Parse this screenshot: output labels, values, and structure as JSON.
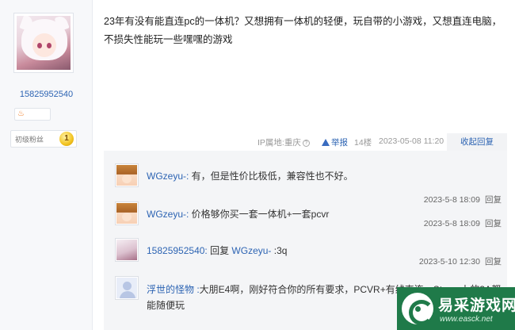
{
  "author": {
    "username": "15825952540",
    "level_label": "初级粉丝",
    "level_number": "1"
  },
  "post": {
    "content": "23年有没有能直连pc的一体机？又想拥有一体机的轻便，玩自带的小游戏，又想直连电脑，不损失性能玩一些嘿嘿的游戏",
    "ip_label": "IP属地:重庆",
    "help_glyph": "?",
    "report_label": "举报",
    "floor": "14楼",
    "date": "2023-05-08 11:20",
    "collapse_label": "收起回复"
  },
  "replies": [
    {
      "name": "WGzeyu-:",
      "text": " 有，但是性价比极低，兼容性也不好。",
      "time": "2023-5-8 18:09",
      "reply_label": "回复",
      "avatar": "anime-girl-avatar"
    },
    {
      "name": "WGzeyu-:",
      "text": " 价格够你买一套一体机+一套pcvr",
      "time": "2023-5-8 18:09",
      "reply_label": "回复",
      "avatar": "anime-girl-avatar"
    },
    {
      "name": "15825952540:",
      "reply_word": " 回复 ",
      "target": "WGzeyu-",
      "text": " :3q",
      "time": "2023-5-10 12:30",
      "reply_label": "回复",
      "avatar": "white-hair-avatar"
    },
    {
      "name": "浮世的怪物 :",
      "text": "大朋E4啊，刚好符合你的所有要求，PCVR+有线直连，Steam上的3A都能随便玩",
      "avatar": "default-avatar"
    }
  ],
  "watermark": {
    "title": "易采游戏网",
    "url": "www.easck.net"
  },
  "colors": {
    "link_blue": "#2d64b3",
    "watermark_green": "#1f7a49",
    "reply_bg": "#f4f5f7"
  }
}
